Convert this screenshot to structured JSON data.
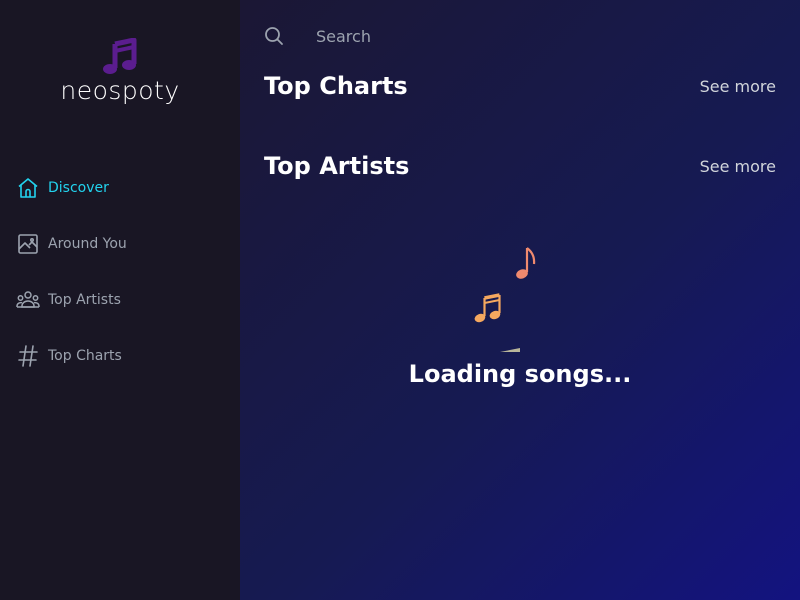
{
  "app": {
    "logo_text": "neospoty"
  },
  "sidebar": {
    "items": [
      {
        "label": "Discover",
        "icon": "home-icon",
        "active": true
      },
      {
        "label": "Around You",
        "icon": "image-icon",
        "active": false
      },
      {
        "label": "Top Artists",
        "icon": "users-icon",
        "active": false
      },
      {
        "label": "Top Charts",
        "icon": "hash-icon",
        "active": false
      }
    ]
  },
  "search": {
    "placeholder": "Search",
    "value": ""
  },
  "main": {
    "sections": [
      {
        "title": "Top Charts",
        "see_more": "See more"
      },
      {
        "title": "Top Artists",
        "see_more": "See more"
      }
    ],
    "loading_text": "Loading songs..."
  },
  "colors": {
    "sidebar_bg": "#191624",
    "accent_active": "#22d3ee",
    "logo_purple": "#5b1d8f",
    "note_coral": "#f08a6e",
    "note_orange": "#f5a85f",
    "note_sage": "#b8b59a"
  }
}
